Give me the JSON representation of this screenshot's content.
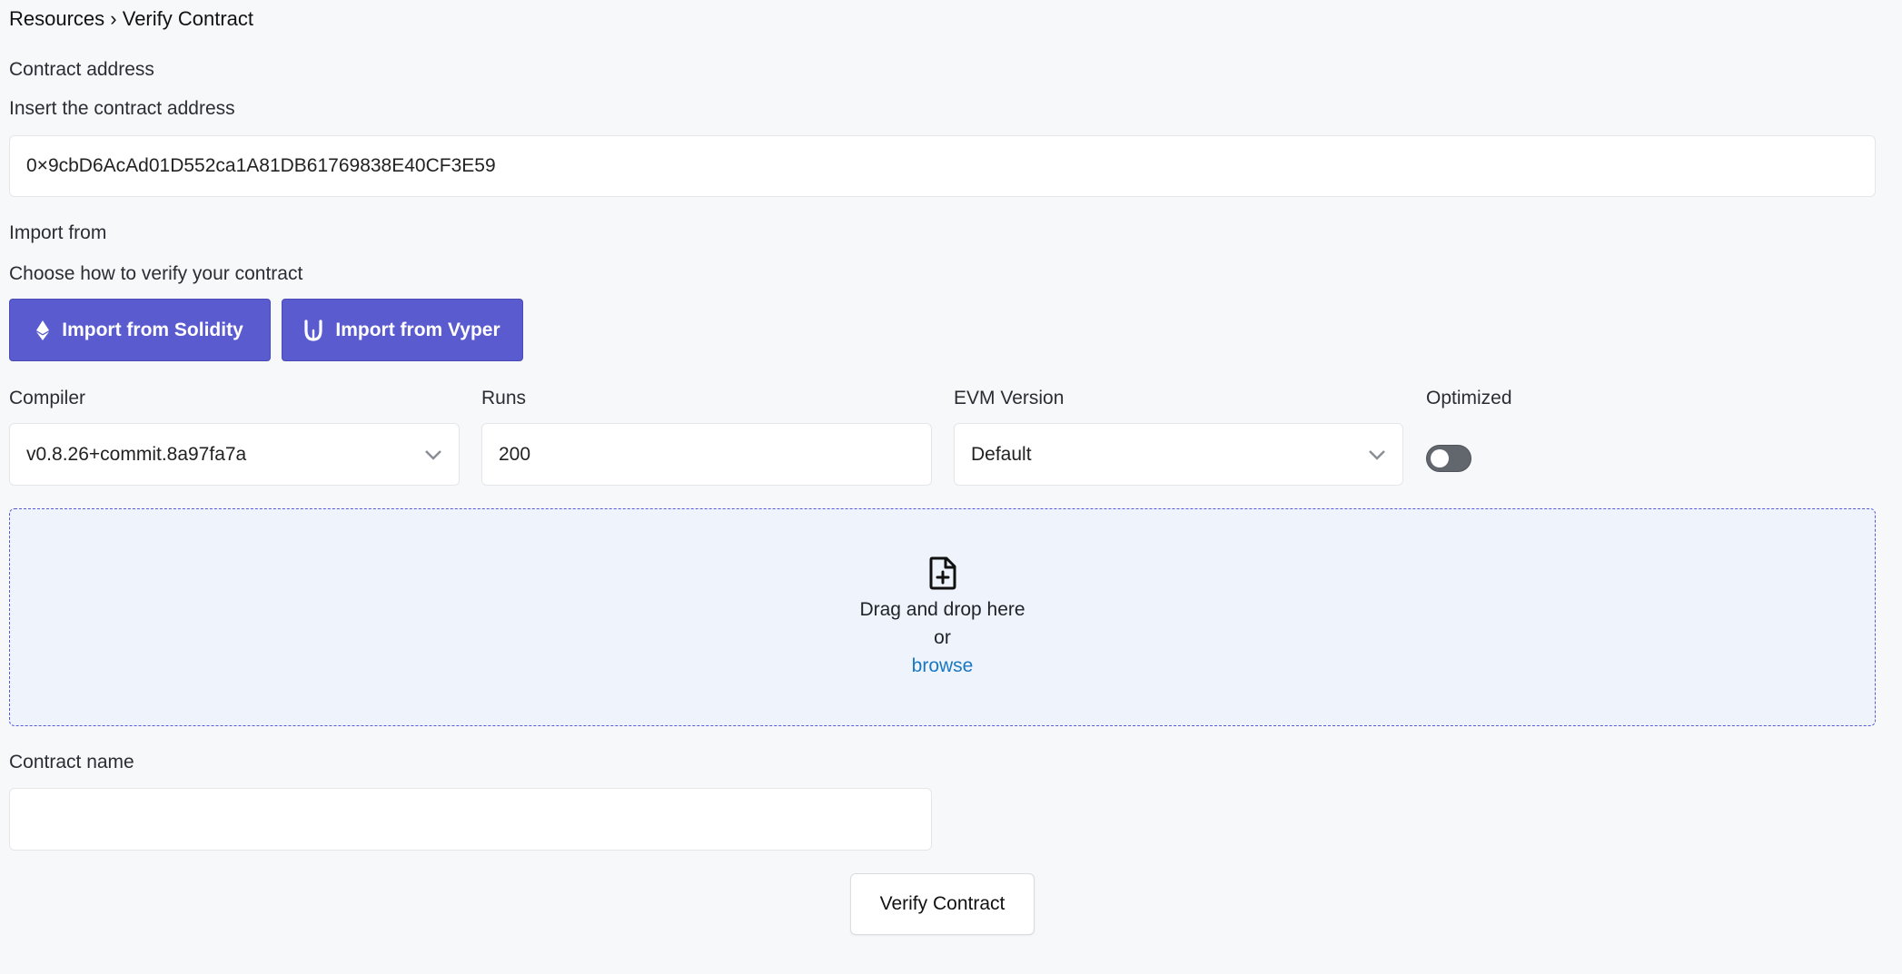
{
  "breadcrumb": {
    "parent": "Resources",
    "separator": "›",
    "current": "Verify Contract"
  },
  "address": {
    "label": "Contract address",
    "hint": "Insert the contract address",
    "value": "0×9cbD6AcAd01D552ca1A81DB61769838E40CF3E59"
  },
  "import": {
    "label": "Import from",
    "hint": "Choose how to verify your contract",
    "solidity_label": "Import from Solidity",
    "solidity_icon": "ethereum-icon",
    "vyper_label": "Import from Vyper",
    "vyper_icon": "vyper-icon"
  },
  "settings": {
    "compiler_label": "Compiler",
    "compiler_value": "v0.8.26+commit.8a97fa7a",
    "runs_label": "Runs",
    "runs_value": "200",
    "evm_label": "EVM Version",
    "evm_value": "Default",
    "optimized_label": "Optimized",
    "optimized_on": false
  },
  "dropzone": {
    "icon": "file-plus-icon",
    "line1": "Drag and drop here",
    "line2": "or",
    "link": "browse"
  },
  "contract_name": {
    "label": "Contract name",
    "value": ""
  },
  "verify_button": "Verify Contract",
  "colors": {
    "primary": "#5b5bd0",
    "link": "#1a78c2",
    "dropzone_bg": "#eef3fc",
    "toggle_off": "#62666d"
  }
}
